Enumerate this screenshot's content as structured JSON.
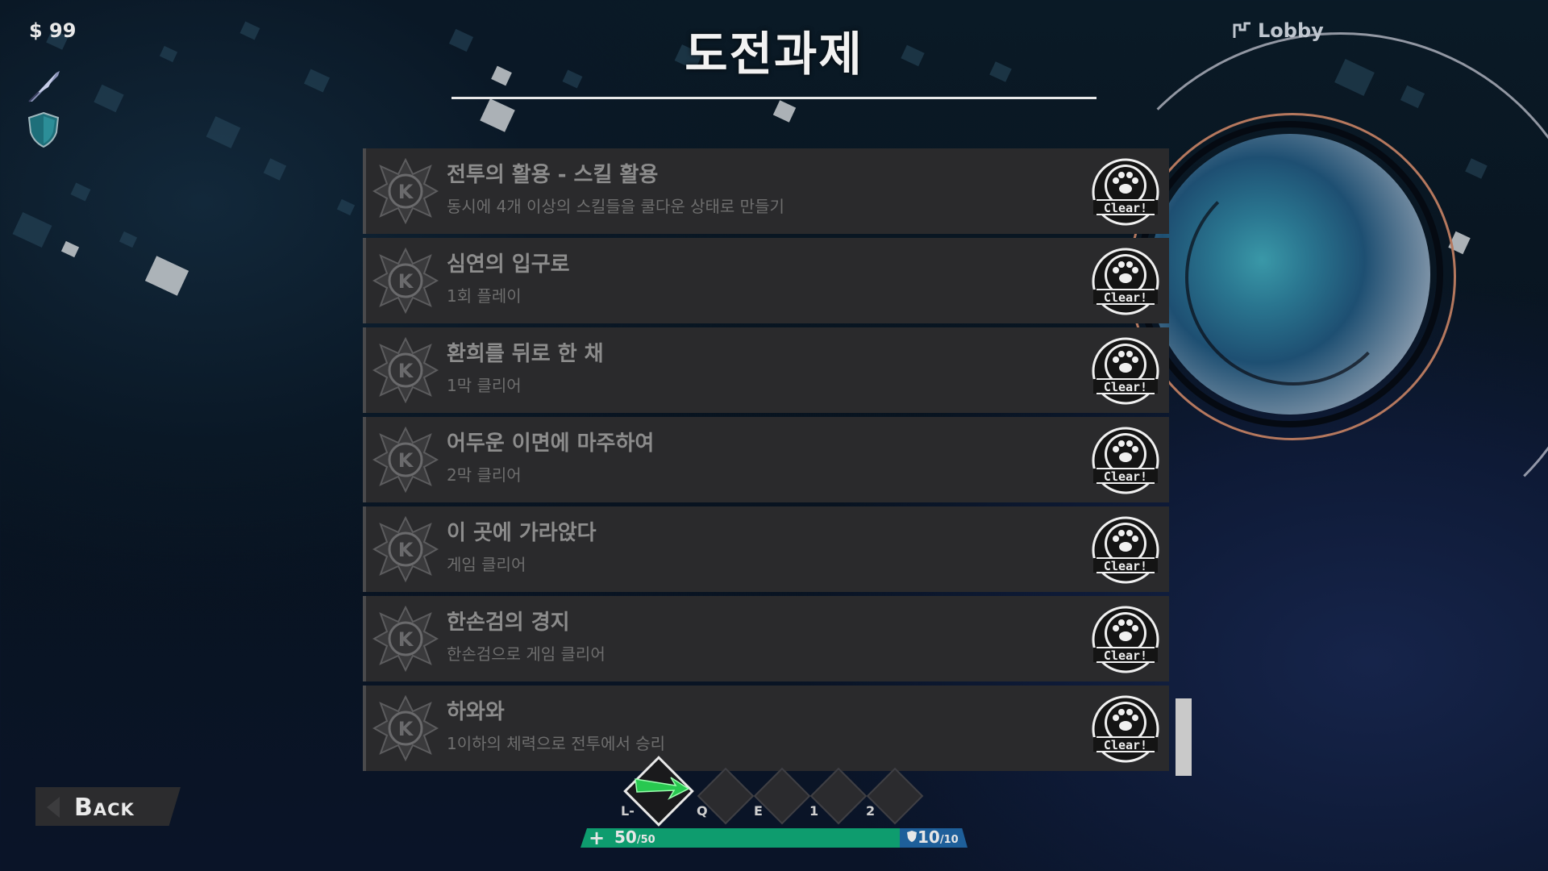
{
  "hud": {
    "money": "$ 99",
    "lobby_label": "Lobby",
    "icons": [
      "feather-sword-icon",
      "shield-icon"
    ]
  },
  "screen": {
    "title": "도전과제"
  },
  "achievements": [
    {
      "title": "전투의 활용 - 스킬 활용",
      "description": "동시에 4개 이상의 스킬들을 쿨다운 상태로 만들기",
      "status": "Clear!"
    },
    {
      "title": "심연의 입구로",
      "description": "1회 플레이",
      "status": "Clear!"
    },
    {
      "title": "환희를 뒤로 한 채",
      "description": "1막 클리어",
      "status": "Clear!"
    },
    {
      "title": "어두운 이면에 마주하여",
      "description": "2막 클리어",
      "status": "Clear!"
    },
    {
      "title": "이 곳에 가라앉다",
      "description": "게임 클리어",
      "status": "Clear!"
    },
    {
      "title": "한손검의 경지",
      "description": "한손검으로 게임 클리어",
      "status": "Clear!"
    },
    {
      "title": "하와와",
      "description": "1이하의 체력으로 전투에서 승리",
      "status": "Clear!"
    }
  ],
  "skillbar": {
    "keys": [
      "L-",
      "Q",
      "E",
      "1",
      "2"
    ]
  },
  "health": {
    "current": "50",
    "max": "/50",
    "shield_current": "10",
    "shield_max": "/10"
  },
  "back_label": "Back",
  "colors": {
    "hp": "#0e9c6e",
    "shield": "#1e5f9a",
    "row_bg": "#2a2a2c"
  }
}
